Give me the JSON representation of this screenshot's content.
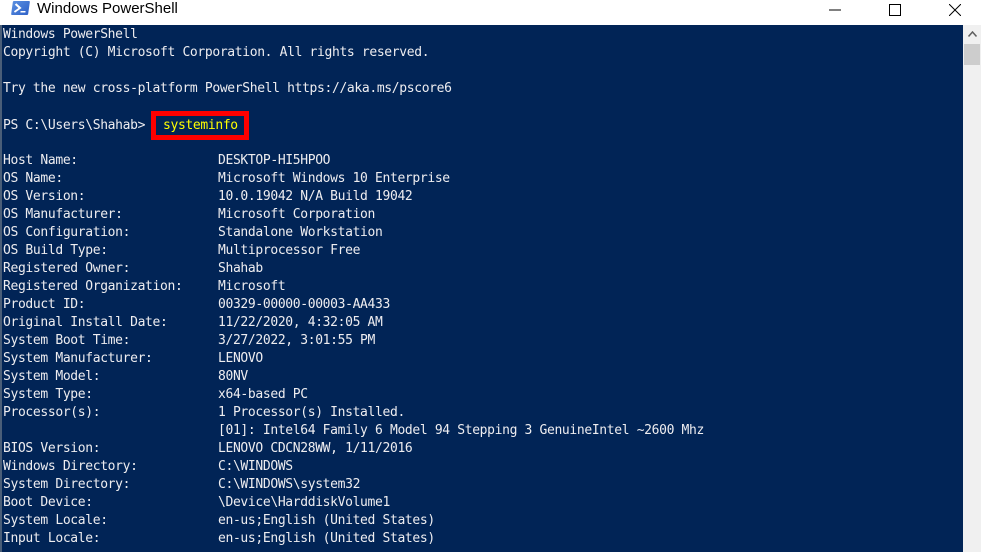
{
  "window": {
    "title": "Windows PowerShell",
    "icon": "powershell-icon",
    "controls": {
      "minimize": "minimize-icon",
      "maximize": "maximize-icon",
      "close": "close-icon"
    }
  },
  "console": {
    "banner": [
      "Windows PowerShell",
      "Copyright (C) Microsoft Corporation. All rights reserved.",
      "",
      "Try the new cross-platform PowerShell https://aka.ms/pscore6"
    ],
    "prompt": "PS C:\\Users\\Shahab>",
    "command": "systeminfo",
    "highlight_color": "#ff0000",
    "command_color": "#ffff00",
    "background_color": "#012456",
    "output": [
      {
        "label": "Host Name:",
        "value": "DESKTOP-HI5HPOO"
      },
      {
        "label": "OS Name:",
        "value": "Microsoft Windows 10 Enterprise"
      },
      {
        "label": "OS Version:",
        "value": "10.0.19042 N/A Build 19042"
      },
      {
        "label": "OS Manufacturer:",
        "value": "Microsoft Corporation"
      },
      {
        "label": "OS Configuration:",
        "value": "Standalone Workstation"
      },
      {
        "label": "OS Build Type:",
        "value": "Multiprocessor Free"
      },
      {
        "label": "Registered Owner:",
        "value": "Shahab"
      },
      {
        "label": "Registered Organization:",
        "value": "Microsoft"
      },
      {
        "label": "Product ID:",
        "value": "00329-00000-00003-AA433"
      },
      {
        "label": "Original Install Date:",
        "value": "11/22/2020, 4:32:05 AM"
      },
      {
        "label": "System Boot Time:",
        "value": "3/27/2022, 3:01:55 PM"
      },
      {
        "label": "System Manufacturer:",
        "value": "LENOVO"
      },
      {
        "label": "System Model:",
        "value": "80NV"
      },
      {
        "label": "System Type:",
        "value": "x64-based PC"
      },
      {
        "label": "Processor(s):",
        "value": "1 Processor(s) Installed."
      },
      {
        "label": "",
        "value": "[01]: Intel64 Family 6 Model 94 Stepping 3 GenuineIntel ~2600 Mhz"
      },
      {
        "label": "BIOS Version:",
        "value": "LENOVO CDCN28WW, 1/11/2016"
      },
      {
        "label": "Windows Directory:",
        "value": "C:\\WINDOWS"
      },
      {
        "label": "System Directory:",
        "value": "C:\\WINDOWS\\system32"
      },
      {
        "label": "Boot Device:",
        "value": "\\Device\\HarddiskVolume1"
      },
      {
        "label": "System Locale:",
        "value": "en-us;English (United States)"
      },
      {
        "label": "Input Locale:",
        "value": "en-us;English (United States)"
      }
    ]
  },
  "scrollbar": {
    "up_arrow": "chevron-up-icon"
  }
}
